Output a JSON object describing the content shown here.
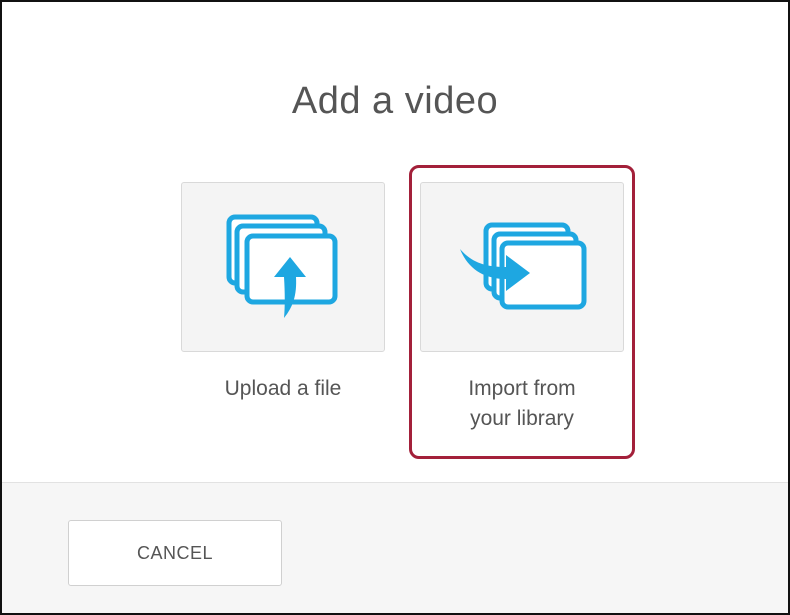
{
  "dialog": {
    "title": "Add a video",
    "options": [
      {
        "label": "Upload a file",
        "icon": "upload-file-icon"
      },
      {
        "label": "Import from your library",
        "icon": "import-library-icon",
        "highlighted": true
      }
    ],
    "cancel_label": "CANCEL"
  },
  "colors": {
    "icon_blue": "#1ea7e1",
    "highlight": "#a3203a",
    "text": "#555555"
  }
}
